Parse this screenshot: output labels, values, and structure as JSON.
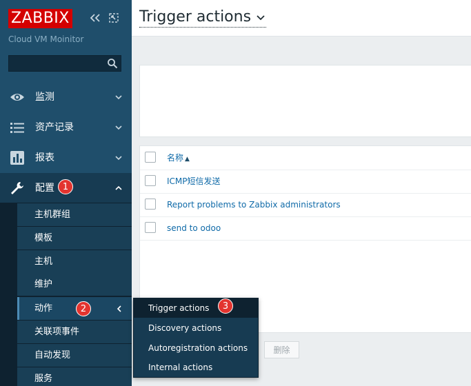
{
  "app": {
    "logo_text": "ZABBIX",
    "server_name": "Cloud VM Moinitor",
    "search_value": ""
  },
  "colors": {
    "sidebar_bg": "#1f4e6b",
    "logo_red": "#d40000",
    "link_blue": "#0f6aa8",
    "badge_red": "#e3342f"
  },
  "sidebar": {
    "menu": [
      {
        "label": "监测",
        "icon": "eye-icon"
      },
      {
        "label": "资产记录",
        "icon": "list-icon"
      },
      {
        "label": "报表",
        "icon": "bar-chart-icon"
      },
      {
        "label": "配置",
        "icon": "wrench-icon",
        "active": true
      }
    ],
    "submenu": [
      {
        "label": "主机群组"
      },
      {
        "label": "模板"
      },
      {
        "label": "主机"
      },
      {
        "label": "维护"
      },
      {
        "label": "动作",
        "active": true
      },
      {
        "label": "关联项事件"
      },
      {
        "label": "自动发现"
      },
      {
        "label": "服务"
      }
    ]
  },
  "flyout": {
    "items": [
      {
        "label": "Trigger actions",
        "active": true
      },
      {
        "label": "Discovery actions"
      },
      {
        "label": "Autoregistration actions"
      },
      {
        "label": "Internal actions"
      }
    ]
  },
  "badges": {
    "one": "1",
    "two": "2",
    "three": "3"
  },
  "header": {
    "title": "Trigger actions"
  },
  "table": {
    "column_name": "名称",
    "sort_indicator": "▲",
    "rows": [
      {
        "name": "ICMP短信发送"
      },
      {
        "name": "Report problems to Zabbix administrators"
      },
      {
        "name": "send to odoo"
      }
    ]
  },
  "footer": {
    "delete_label": "删除"
  }
}
